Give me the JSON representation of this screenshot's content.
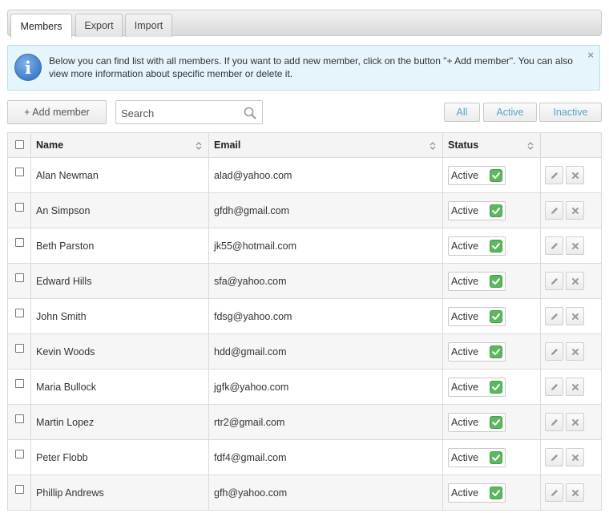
{
  "tabs": [
    {
      "label": "Members",
      "active": true
    },
    {
      "label": "Export",
      "active": false
    },
    {
      "label": "Import",
      "active": false
    }
  ],
  "alert": {
    "icon": "info-icon",
    "icon_glyph": "i",
    "text": "Below you can find list with all members. If you want to add new member, click on the button \"+ Add member\". You can also view more information about specific member or delete it.",
    "close_glyph": "×"
  },
  "toolbar": {
    "add_label": "+ Add member",
    "search_placeholder": "Search",
    "filters": [
      "All",
      "Active",
      "Inactive"
    ]
  },
  "table": {
    "headers": {
      "name": "Name",
      "email": "Email",
      "status": "Status"
    },
    "rows": [
      {
        "name": "Alan Newman",
        "email": "alad@yahoo.com",
        "status": "Active"
      },
      {
        "name": "An Simpson",
        "email": "gfdh@gmail.com",
        "status": "Active"
      },
      {
        "name": "Beth Parston",
        "email": "jk55@hotmail.com",
        "status": "Active"
      },
      {
        "name": "Edward Hills",
        "email": "sfa@yahoo.com",
        "status": "Active"
      },
      {
        "name": "John Smith",
        "email": "fdsg@yahoo.com",
        "status": "Active"
      },
      {
        "name": "Kevin Woods",
        "email": "hdd@gmail.com",
        "status": "Active"
      },
      {
        "name": "Maria Bullock",
        "email": "jgfk@yahoo.com",
        "status": "Active"
      },
      {
        "name": "Martin Lopez",
        "email": "rtr2@gmail.com",
        "status": "Active"
      },
      {
        "name": "Peter Flobb",
        "email": "fdf4@gmail.com",
        "status": "Active"
      },
      {
        "name": "Phillip Andrews",
        "email": "gfh@yahoo.com",
        "status": "Active"
      }
    ]
  },
  "colors": {
    "accent": "#5aa3c6",
    "status_ok": "#5cb85c",
    "alert_bg": "#e6f5fb"
  }
}
